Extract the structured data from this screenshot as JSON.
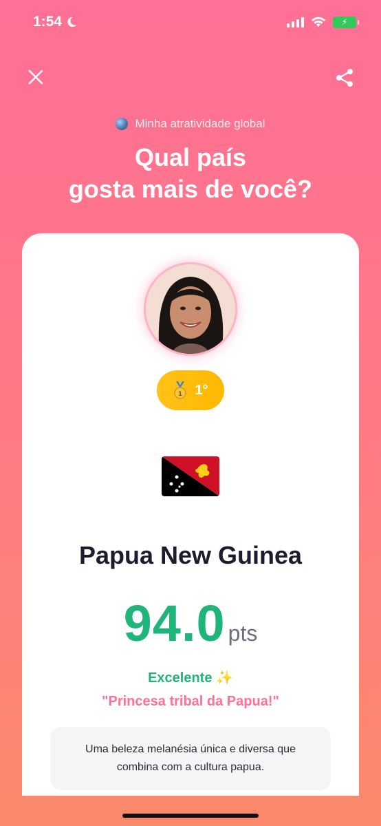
{
  "status_bar": {
    "time": "1:54"
  },
  "header": {
    "subtitle": "Minha atratividade global",
    "title_line1": "Qual país",
    "title_line2": "gosta mais de você?"
  },
  "result": {
    "rank": "1°",
    "country": "Papua New Guinea",
    "score": "94.0",
    "score_unit": "pts",
    "rating": "Excelente",
    "rating_emoji": "✨",
    "tagline": "\"Princesa tribal da Papua!\"",
    "description": "Uma beleza melanésia única e diversa que combina com a cultura papua."
  },
  "colors": {
    "gradient_top": "#ff6f96",
    "gradient_bottom": "#fb8a6d",
    "score_green": "#1fb57a",
    "tagline_pink": "#ff6f96",
    "badge_gold": "#ffc21a"
  },
  "icons": [
    "moon-icon",
    "signal-icon",
    "wifi-icon",
    "battery-icon",
    "close-icon",
    "share-icon",
    "globe-icon",
    "medal-icon",
    "flag-icon"
  ]
}
